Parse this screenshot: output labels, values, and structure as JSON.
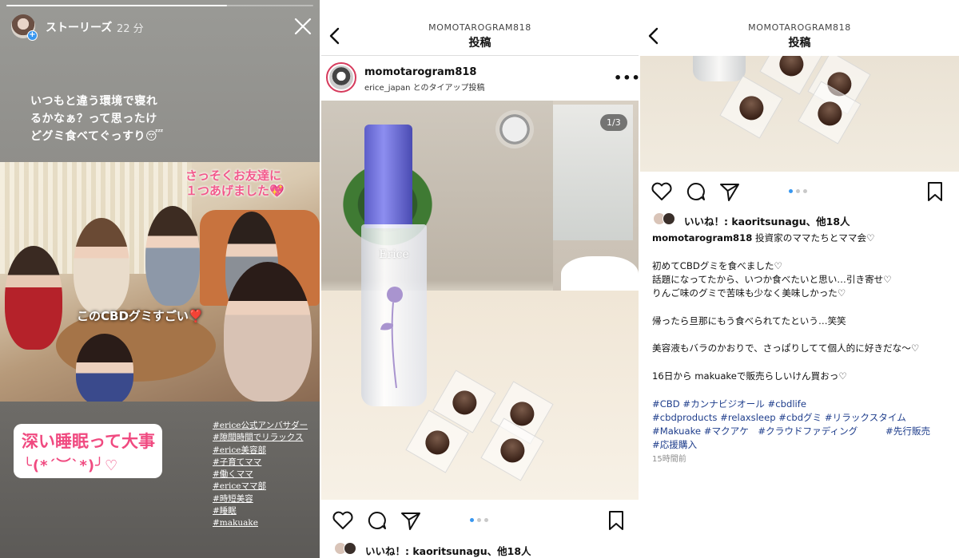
{
  "story": {
    "username": "ストーリーズ",
    "time": "22 分",
    "text_lines": [
      "いつもと違う環境で寝れ",
      "るかなぁ？って思ったけ",
      "どグミ食べてぐっすり😴"
    ],
    "photo_caption_top": [
      "さっそくお友達に",
      "１つあげました💖"
    ],
    "photo_caption_mid": "このCBDグミすごい❣️",
    "sticker_line1": "深い睡眠って大事",
    "sticker_line2": "╰(*´︶`*)╯♡",
    "hashtags": [
      "#erice公式アンバサダー",
      "#隙間時間でリラックス",
      "#erice美容部",
      "#子育てママ",
      "#働くママ",
      "#ericeママ部",
      "#時短美容",
      "#睡眠",
      "#makuake"
    ]
  },
  "post1": {
    "header_user": "MOMOTAROGRAM818",
    "header_title": "投稿",
    "username": "momotarogram818",
    "subtitle": "erice_japan とのタイアップ投稿",
    "more": "•••",
    "counter": "1/3",
    "bottle_label": "Erice",
    "likes_text": "いいね！: kaoritsunagu、他18人"
  },
  "post2": {
    "header_user": "MOMOTAROGRAM818",
    "header_title": "投稿",
    "likes_text": "いいね！: kaoritsunagu、他18人",
    "caption_user": "momotarogram818",
    "caption_first": " 投資家のママたちとママ会♡",
    "caption_lines": [
      "",
      "初めてCBDグミを食べました♡",
      "話題になってたから、いつか食べたいと思い…引き寄せ♡",
      "りんご味のグミで苦味も少なく美味しかった♡",
      "",
      "帰ったら旦那にもう食べられてたという…笑笑",
      "",
      "美容液もバラのかおりで、さっぱりしてて個人的に好きだな〜♡",
      "",
      "16日から makuakeで販売らしいけん買おっ♡",
      ""
    ],
    "tag_lines": [
      "#CBD #カンナビジオール #cbdlife",
      "#cbdproducts #relaxsleep #cbdグミ #リラックスタイム",
      "#Makuake #マクアケ　#クラウドファディング　　　#先行販売",
      "#応援購入"
    ],
    "timestamp": "15時間前"
  },
  "colors": {
    "accent": "#3897f0",
    "sticker_pink": "#f04a80",
    "hashtag_blue": "#1f3e8c",
    "bottle_cap": "#6b6cd8"
  }
}
